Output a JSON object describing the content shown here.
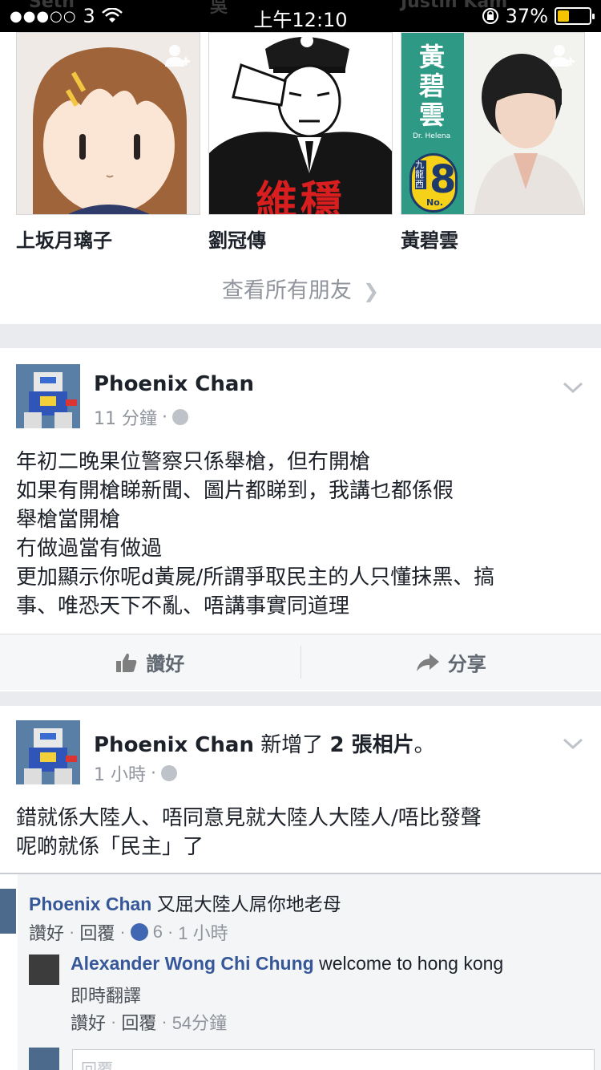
{
  "status_bar": {
    "carrier_dots": "●●●○○",
    "carrier": "3",
    "time": "上午12:10",
    "battery_percent": "37%",
    "battery_level": 0.37
  },
  "header_ghost": {
    "names": [
      "Seth",
      "吳",
      "Justin Kam"
    ]
  },
  "friends": {
    "items": [
      {
        "name": "上坂月璃子",
        "photo_icon": "anime-girl-avatar"
      },
      {
        "name": "劉冠傳",
        "photo_icon": "saluting-officer-avatar",
        "overlay_text": "維穩"
      },
      {
        "name": "黃碧雲",
        "photo_icon": "campaign-poster-avatar",
        "poster_text": "黃碧雲",
        "poster_sub": "Dr. Helena",
        "poster_number": "8",
        "poster_district": "九龍西",
        "poster_no": "No."
      }
    ],
    "see_all_label": "查看所有朋友"
  },
  "post1": {
    "author": "Phoenix Chan",
    "time": "11 分鐘",
    "lines": [
      "年初二晚果位警察只係舉槍，但冇開槍",
      "如果有開槍睇新聞、圖片都睇到，我講乜都係假",
      "舉槍當開槍",
      "冇做過當有做過",
      "更加顯示你呢d黃屍/所謂爭取民主的人只懂抹黑、搞",
      "事、唯恐天下不亂、唔講事實同道理"
    ],
    "like_label": "讚好",
    "share_label": "分享"
  },
  "post2": {
    "author": "Phoenix Chan",
    "action": "新增了",
    "count": "2 張相片",
    "period": "。",
    "time": "1 小時",
    "lines": [
      "錯就係大陸人、唔同意見就大陸人大陸人/唔比發聲",
      "呢啲就係「民主」了"
    ]
  },
  "embedded": {
    "comment1": {
      "name": "Phoenix Chan",
      "text": "又屈大陸人屌你地老母",
      "like": "讚好",
      "reply": "回覆",
      "likes": "6",
      "time": "1 小時"
    },
    "comment2": {
      "name": "Alexander Wong Chi Chung",
      "text": "welcome to hong kong",
      "translate": "即時翻譯",
      "like": "讚好",
      "reply": "回覆",
      "time": "54分鐘"
    },
    "reply_placeholder": "回覆……"
  }
}
